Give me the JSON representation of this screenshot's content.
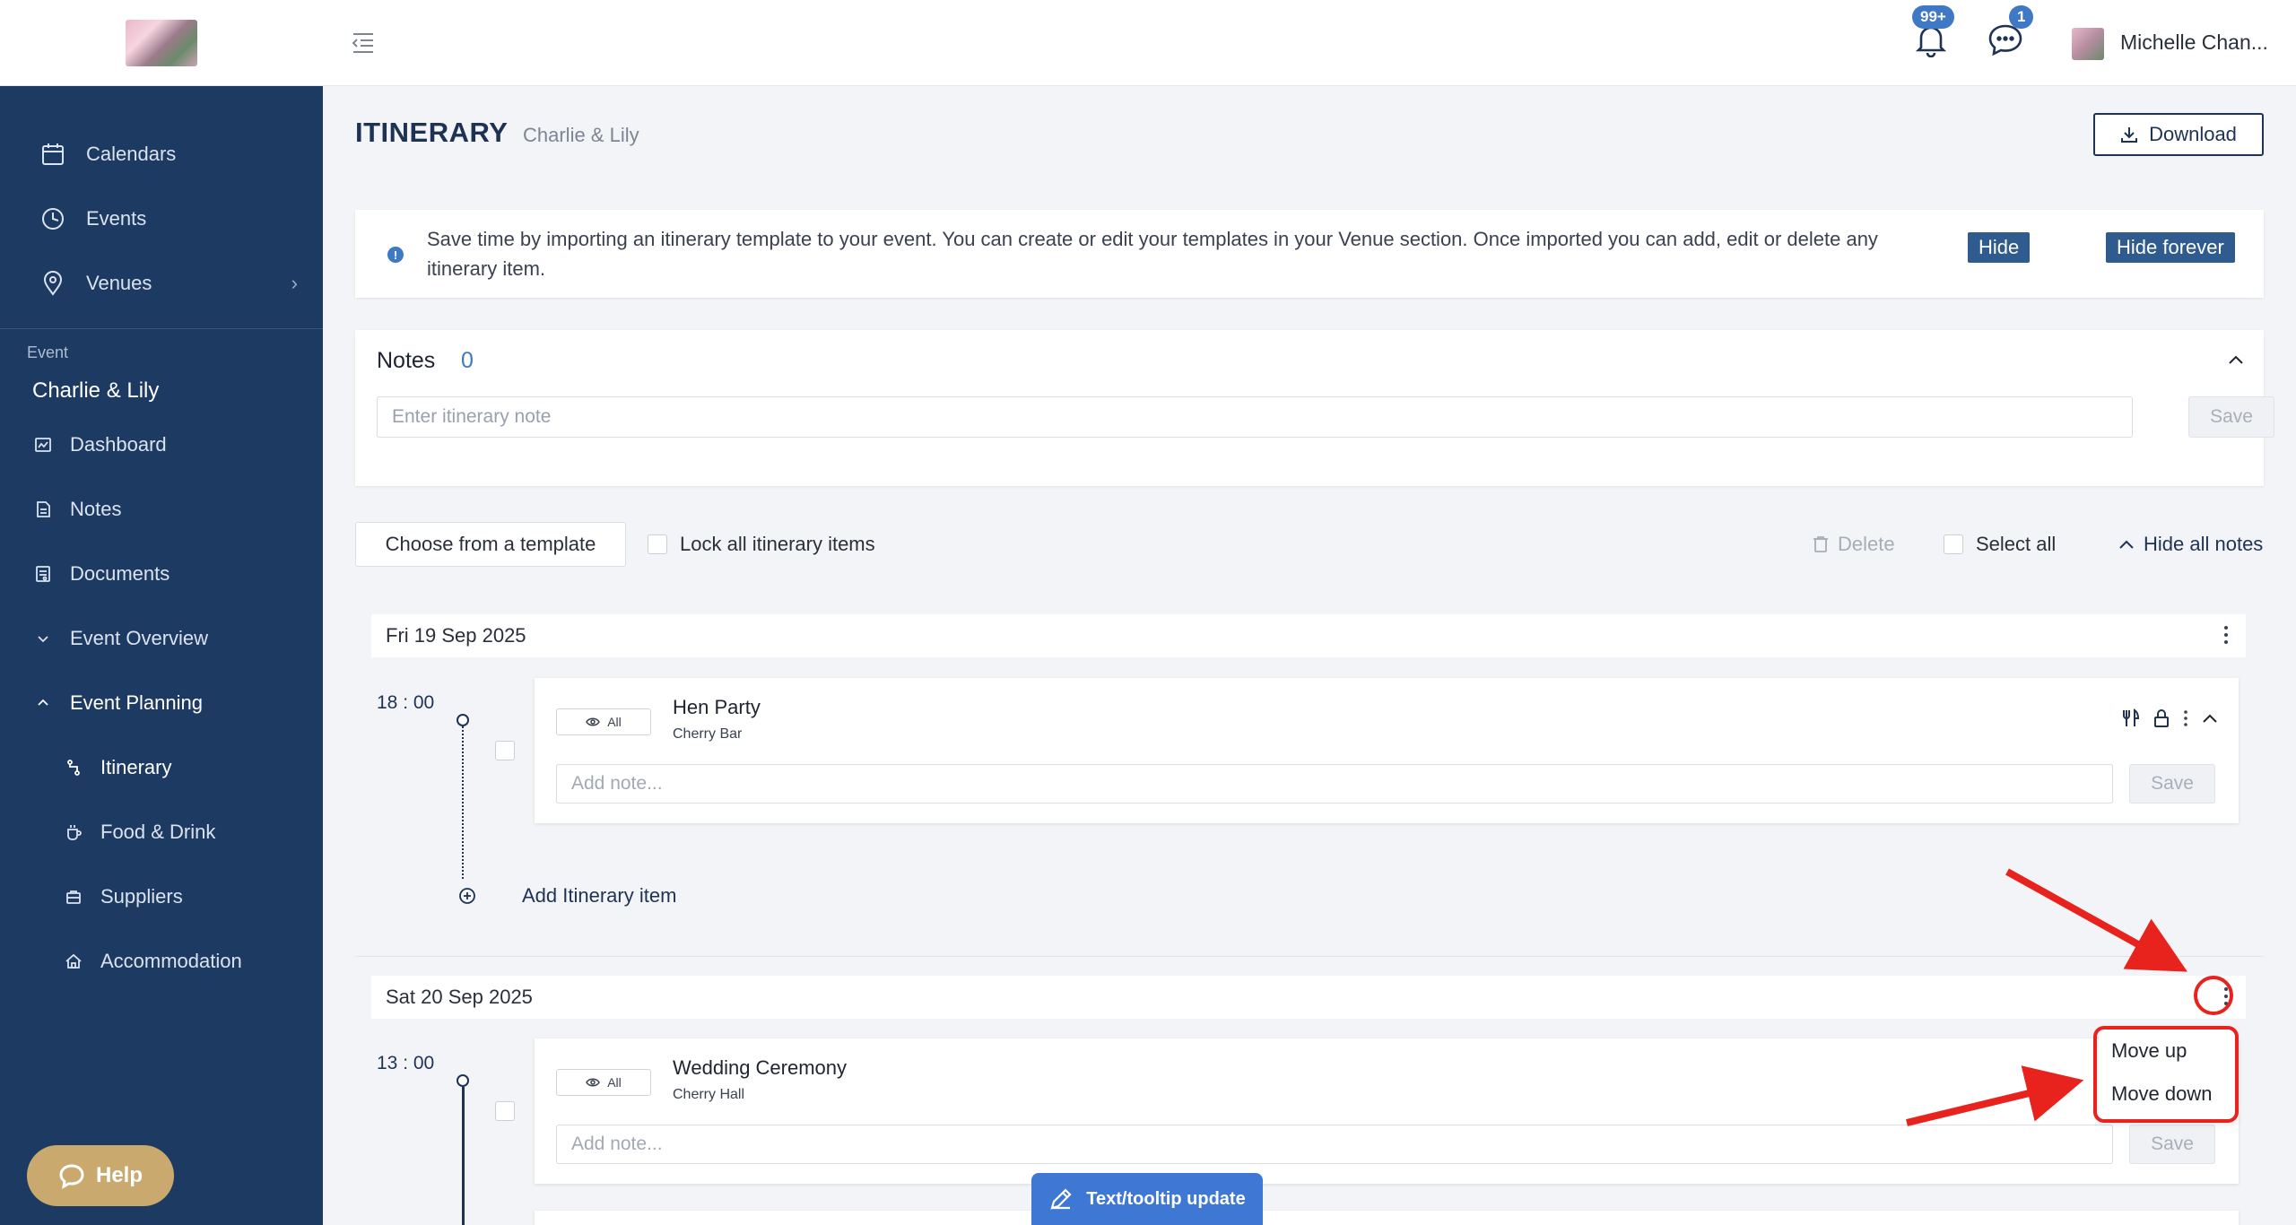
{
  "sidebar": {
    "nav": [
      {
        "label": "Calendars",
        "icon": "calendar-icon"
      },
      {
        "label": "Events",
        "icon": "clock-icon"
      },
      {
        "label": "Venues",
        "icon": "location-pin-icon"
      }
    ],
    "event_caption": "Event",
    "event_name": "Charlie & Lily",
    "event_nav": [
      {
        "label": "Dashboard",
        "icon": "dashboard-icon"
      },
      {
        "label": "Notes",
        "icon": "note-icon"
      },
      {
        "label": "Documents",
        "icon": "document-icon"
      },
      {
        "label": "Event Overview",
        "icon": "chevron-down-icon"
      },
      {
        "label": "Event Planning",
        "icon": "chevron-up-icon"
      }
    ],
    "planning_children": [
      {
        "label": "Itinerary",
        "icon": "itinerary-icon",
        "active": true
      },
      {
        "label": "Food & Drink",
        "icon": "cup-icon"
      },
      {
        "label": "Suppliers",
        "icon": "briefcase-icon"
      },
      {
        "label": "Accommodation",
        "icon": "home-icon"
      }
    ],
    "help_label": "Help"
  },
  "topbar": {
    "notifications_badge": "99+",
    "messages_badge": "1",
    "user_name": "Michelle Chan..."
  },
  "page": {
    "title": "ITINERARY",
    "subtitle": "Charlie & Lily",
    "download_label": "Download"
  },
  "info": {
    "text": "Save time by importing an itinerary template to your event. You can create or edit your templates in your Venue section. Once imported you can add, edit or delete any itinerary item.",
    "hide_label": "Hide",
    "hide_forever_label": "Hide forever"
  },
  "notes": {
    "title": "Notes",
    "count": "0",
    "placeholder": "Enter itinerary note",
    "save_label": "Save"
  },
  "toolbar": {
    "template_label": "Choose from a template",
    "lock_label": "Lock all itinerary items",
    "delete_label": "Delete",
    "select_all_label": "Select all",
    "hide_notes_label": "Hide all notes"
  },
  "days": [
    {
      "date": "Fri 19 Sep 2025",
      "items": [
        {
          "time": "18 : 00",
          "visibility": "All",
          "title": "Hen Party",
          "location": "Cherry Bar",
          "note_placeholder": "Add note...",
          "save_label": "Save"
        }
      ],
      "add_label": "Add Itinerary item"
    },
    {
      "date": "Sat 20 Sep 2025",
      "items": [
        {
          "time": "13 : 00",
          "visibility": "All",
          "title": "Wedding Ceremony",
          "location": "Cherry Hall",
          "note_placeholder": "Add note...",
          "save_label": "Save"
        }
      ]
    }
  ],
  "day_menu": {
    "move_up": "Move up",
    "move_down": "Move down"
  },
  "annotation_color": "#e8221c",
  "tooltip_update_label": "Text/tooltip update"
}
